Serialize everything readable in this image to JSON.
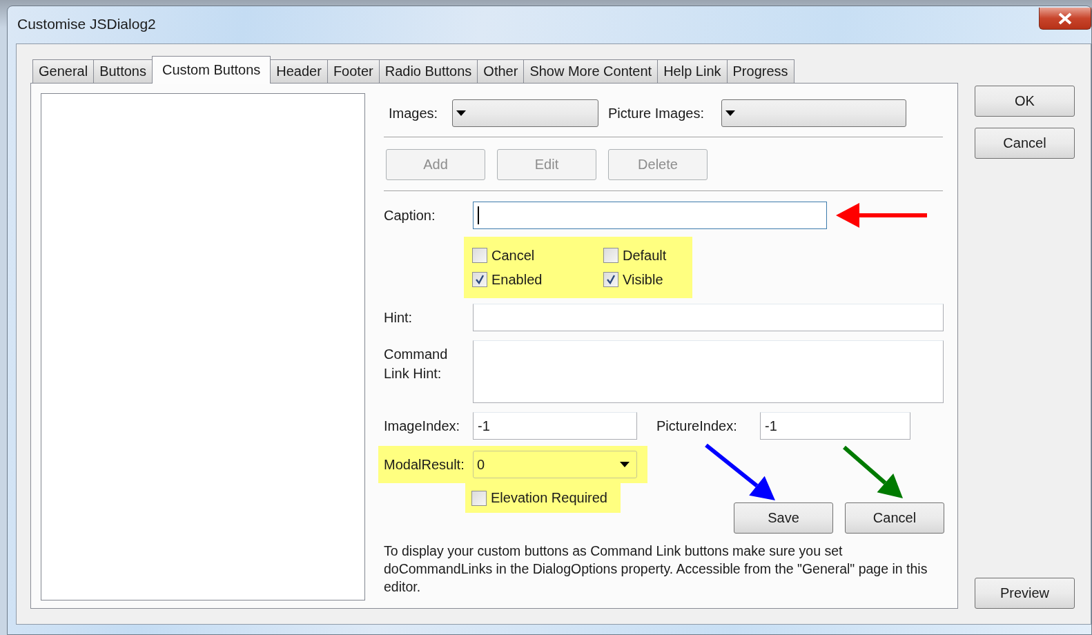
{
  "window": {
    "title": "Customise JSDialog2"
  },
  "tabs": [
    {
      "label": "General",
      "selected": false
    },
    {
      "label": "Buttons",
      "selected": false
    },
    {
      "label": "Custom Buttons",
      "selected": true
    },
    {
      "label": "Header",
      "selected": false
    },
    {
      "label": "Footer",
      "selected": false
    },
    {
      "label": "Radio Buttons",
      "selected": false
    },
    {
      "label": "Other",
      "selected": false
    },
    {
      "label": "Show More Content",
      "selected": false
    },
    {
      "label": "Help Link",
      "selected": false
    },
    {
      "label": "Progress",
      "selected": false
    }
  ],
  "images": {
    "label": "Images:"
  },
  "picture_images": {
    "label": "Picture Images:"
  },
  "list_buttons": [
    {
      "label": "Add",
      "disabled": true
    },
    {
      "label": "Edit",
      "disabled": true
    },
    {
      "label": "Delete",
      "disabled": true
    }
  ],
  "caption": {
    "label": "Caption:",
    "focused": true
  },
  "options": {
    "highlighted": true,
    "items": [
      {
        "label": "Cancel",
        "checked": false
      },
      {
        "label": "Default",
        "checked": false
      },
      {
        "label": "Enabled",
        "checked": true
      },
      {
        "label": "Visible",
        "checked": true
      }
    ]
  },
  "hint": {
    "label": "Hint:"
  },
  "command_link_hint": {
    "label": "Command\nLink Hint:"
  },
  "image_index": {
    "label": "ImageIndex:",
    "value": "-1"
  },
  "picture_index": {
    "label": "PictureIndex:",
    "value": "-1"
  },
  "modal_result": {
    "label": "ModalResult:",
    "value": "0",
    "highlighted": true
  },
  "elevation_required": {
    "label": "Elevation Required",
    "checked": false,
    "highlighted": true
  },
  "action_buttons": [
    "Save",
    "Cancel"
  ],
  "note": "To display your custom buttons as Command Link buttons make sure you set doCommandLinks in the DialogOptions property. Accessible from the \"General\" page in this editor.",
  "dialog_buttons": [
    "OK",
    "Cancel"
  ],
  "preview_button": "Preview",
  "annotations": [
    {
      "kind": "arrow",
      "color": "#ff0000"
    },
    {
      "kind": "arrow",
      "color": "#0000ff"
    },
    {
      "kind": "arrow",
      "color": "#007a00"
    }
  ]
}
